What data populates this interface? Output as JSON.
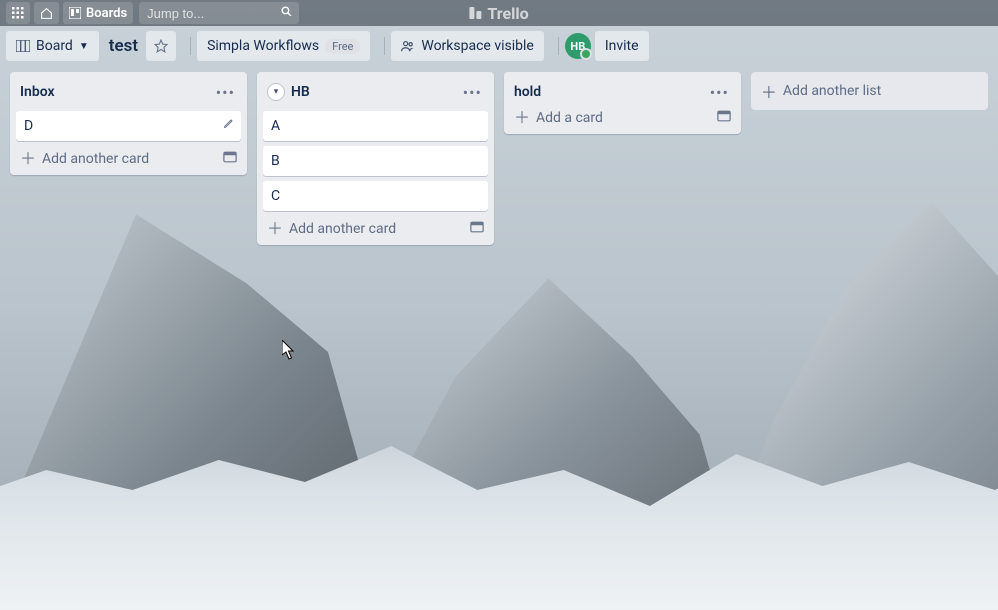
{
  "topbar": {
    "boards_label": "Boards",
    "search_placeholder": "Jump to...",
    "brand": "Trello"
  },
  "boardbar": {
    "view_label": "Board",
    "board_title": "test",
    "powerup_label": "Simpla Workflows",
    "powerup_badge": "Free",
    "visibility_label": "Workspace visible",
    "avatar_initials": "HB",
    "invite_label": "Invite"
  },
  "lists": [
    {
      "title": "Inbox",
      "collapse_toggle": false,
      "cards": [
        {
          "text": "D",
          "show_edit": true
        }
      ],
      "footer_label": "Add another card"
    },
    {
      "title": "HB",
      "collapse_toggle": true,
      "cards": [
        {
          "text": "A",
          "show_edit": false
        },
        {
          "text": "B",
          "show_edit": false
        },
        {
          "text": "C",
          "show_edit": false
        }
      ],
      "footer_label": "Add another card"
    },
    {
      "title": "hold",
      "collapse_toggle": false,
      "cards": [],
      "footer_label": "Add a card"
    }
  ],
  "add_list_label": "Add another list"
}
